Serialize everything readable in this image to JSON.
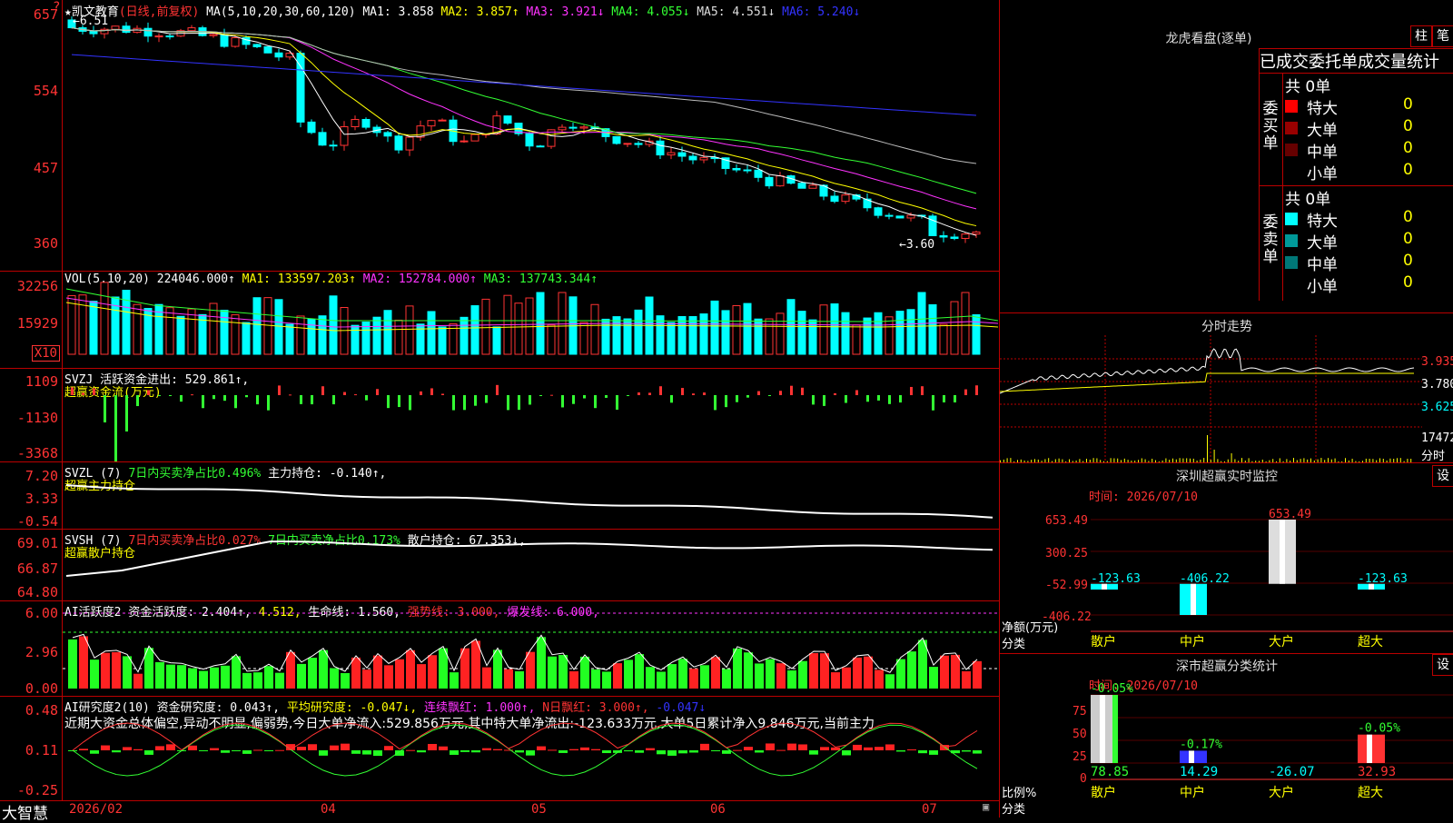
{
  "left": {
    "kline": {
      "title_name": "凯文教育",
      "title_period": "(日线,前复权)",
      "ma_prefix": "MA(5,10,20,30,60,120)",
      "ma": [
        {
          "label": "MA1: 3.858",
          "color": "#ffffff"
        },
        {
          "label": "MA2: 3.857↑",
          "color": "#ffff00"
        },
        {
          "label": "MA3: 3.921↓",
          "color": "#ff33ff"
        },
        {
          "label": "MA4: 4.055↓",
          "color": "#33ff33"
        },
        {
          "label": "MA5: 4.551↓",
          "color": "#dddddd"
        },
        {
          "label": "MA6: 5.240↓",
          "color": "#3333ff"
        }
      ],
      "yticks": [
        "657",
        "554",
        "457",
        "360"
      ],
      "high_note": "←6.51",
      "low_note": "←3.60"
    },
    "vol": {
      "title": "VOL(5,10,20)",
      "val": "224046.000↑",
      "ma1": "MA1: 133597.203↑",
      "ma2": "MA2: 152784.000↑",
      "ma3": "MA3: 137743.344↑",
      "yticks": [
        "32256",
        "15929"
      ],
      "unit": "X10"
    },
    "svzj": {
      "title": "SVZJ",
      "text1": "活跃资金进出: 529.861↑,",
      "sub": "超赢资金流(万元)",
      "yticks": [
        "1109",
        "-1130",
        "-3368"
      ]
    },
    "svzl": {
      "title": "SVZL (7)",
      "text1": "7日内买卖净占比0.496%",
      "text2": "主力持仓: -0.140↑,",
      "sub": "超赢主力持仓",
      "yticks": [
        "7.20",
        "3.33",
        "-0.54"
      ]
    },
    "svsh": {
      "title": "SVSH (7)",
      "text1": "7日内买卖净占比0.027%",
      "text2": "7日内买卖净占比0.173%",
      "text3": "散户持仓: 67.353↓,",
      "sub": "超赢散户持仓",
      "yticks": [
        "69.01",
        "66.87",
        "64.80"
      ]
    },
    "ai1": {
      "title": "AI活跃度2",
      "t1": "资金活跃度: 2.404↑,",
      "t2": "4.512,",
      "t3": "生命线: 1.560,",
      "t4": "强势线: 3.000,",
      "t5": "爆发线: 6.000,",
      "yticks": [
        "6.00",
        "2.96",
        "0.00"
      ]
    },
    "ai2": {
      "title": "AI研究度2(10)",
      "t1": "资金研究度: 0.043↑,",
      "t2": "平均研究度: -0.047↓,",
      "t3": "连续飘红: 1.000↑,",
      "t4": "N日飘红: 3.000↑,",
      "t5": "-0.047↓",
      "comment": "近期大资金总体偏空,异动不明显,偏弱势,今日大单净流入:529.856万元,其中特大单净流出:-123.633万元,大单5日累计净入9.846万元,当前主力",
      "yticks": [
        "0.48",
        "0.11",
        "-0.25"
      ]
    },
    "xaxis": {
      "brand": "大智慧",
      "labels": [
        "2026/02",
        "04",
        "05",
        "06",
        "07"
      ]
    }
  },
  "right": {
    "lhb": {
      "title": "龙虎看盘(逐单)",
      "btn1": "柱",
      "btn2": "笔",
      "header": "已成交委托单成交量统计",
      "buy_label": "委买单",
      "sell_label": "委卖单",
      "buy_total": "共 0单",
      "sell_total": "共 0单",
      "buy": [
        {
          "name": "特大",
          "n": "0",
          "p": "0%",
          "color": "#ff0000"
        },
        {
          "name": "大单",
          "n": "0",
          "p": "0%",
          "color": "#990000"
        },
        {
          "name": "中单",
          "n": "0",
          "p": "0%",
          "color": "#660000"
        },
        {
          "name": "小单",
          "n": "0",
          "p": "0%",
          "color": "#000000"
        }
      ],
      "sell": [
        {
          "name": "特大",
          "n": "0",
          "p": "0%",
          "color": "#00ffff"
        },
        {
          "name": "大单",
          "n": "0",
          "p": "0%",
          "color": "#009999"
        },
        {
          "name": "中单",
          "n": "0",
          "p": "0%",
          "color": "#007777"
        },
        {
          "name": "小单",
          "n": "0",
          "p": "0%",
          "color": "#000000"
        }
      ]
    },
    "fenshi": {
      "title": "分时走势",
      "p1": "3.935",
      "p2": "3.780",
      "p3": "3.625",
      "vol": "17472",
      "vol_unit": "分时"
    },
    "szrt": {
      "title": "深圳超赢实时监控",
      "btn": "设",
      "date": "时间: 2026/07/10",
      "yticks": [
        "653.49",
        "300.25",
        "-52.99",
        "-406.22"
      ],
      "ylabel1": "净额(万元)",
      "ylabel2": "分类",
      "bars": [
        {
          "cat": "散户",
          "value": -123.63,
          "label": "-123.63"
        },
        {
          "cat": "中户",
          "value": -406.22,
          "label": "-406.22"
        },
        {
          "cat": "大户",
          "value": 653.49,
          "label": "653.49"
        },
        {
          "cat": "超大",
          "value": -123.63,
          "label": "-123.63"
        }
      ]
    },
    "szcls": {
      "title": "深市超赢分类统计",
      "btn": "设",
      "date": "时间: 2026/07/10",
      "yticks": [
        "75",
        "50",
        "25",
        "0"
      ],
      "ylabel1": "比例%",
      "ylabel2": "分类",
      "bars": [
        {
          "cat": "散户",
          "ratio": 78.85,
          "bottom": "78.85",
          "top": "-0.05%"
        },
        {
          "cat": "中户",
          "ratio": 14.29,
          "bottom": "14.29",
          "top": "-0.17%"
        },
        {
          "cat": "大户",
          "ratio": 0,
          "bottom": "-26.07",
          "top": ""
        },
        {
          "cat": "超大",
          "ratio": 32.93,
          "bottom": "32.93",
          "top": "-0.05%"
        }
      ]
    }
  }
}
